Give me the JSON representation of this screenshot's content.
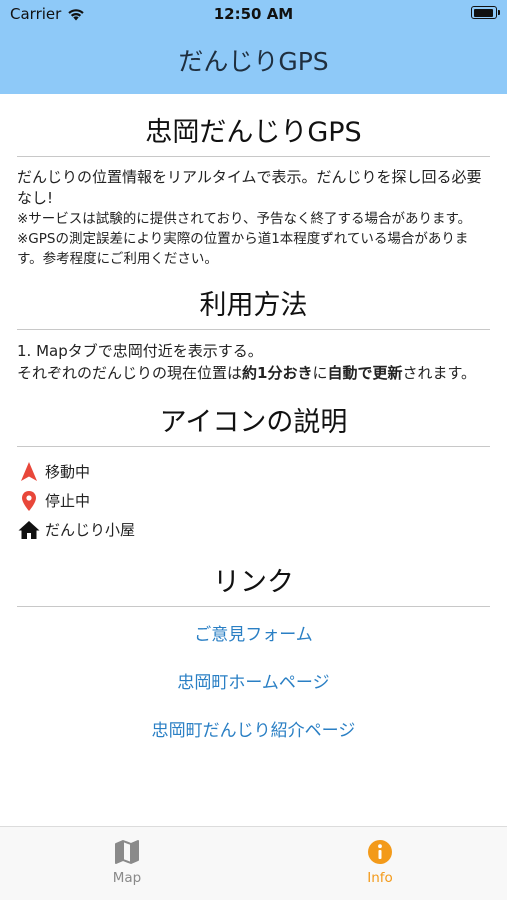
{
  "status": {
    "carrier": "Carrier",
    "time": "12:50 AM"
  },
  "nav": {
    "title": "だんじりGPS"
  },
  "about": {
    "heading": "忠岡だんじりGPS",
    "description": "だんじりの位置情報をリアルタイムで表示。だんじりを探し回る必要なし!",
    "note1": "※サービスは試験的に提供されており、予告なく終了する場合があります。",
    "note2": "※GPSの測定誤差により実際の位置から道1本程度ずれている場合があります。参考程度にご利用ください。"
  },
  "usage": {
    "heading": "利用方法",
    "step1": "1. Mapタブで忠岡付近を表示する。",
    "line2_a": "それぞれのだんじりの現在位置は",
    "line2_b": "約1分おき",
    "line2_c": "に",
    "line2_d": "自動で更新",
    "line2_e": "されます。"
  },
  "legend": {
    "heading": "アイコンの説明",
    "items": [
      {
        "icon": "navigation-arrow-icon",
        "label": "移動中",
        "color": "#e8473a"
      },
      {
        "icon": "map-pin-icon",
        "label": "停止中",
        "color": "#e8473a"
      },
      {
        "icon": "home-icon",
        "label": "だんじり小屋",
        "color": "#111111"
      }
    ]
  },
  "links": {
    "heading": "リンク",
    "items": [
      "ご意見フォーム",
      "忠岡町ホームページ",
      "忠岡町だんじり紹介ページ"
    ],
    "color": "#2a7fc4"
  },
  "tabs": [
    {
      "label": "Map",
      "icon": "map-icon",
      "active": false
    },
    {
      "label": "Info",
      "icon": "info-icon",
      "active": true,
      "color": "#f39a1a"
    }
  ],
  "theme": {
    "header_bg": "#8ec9f8"
  }
}
